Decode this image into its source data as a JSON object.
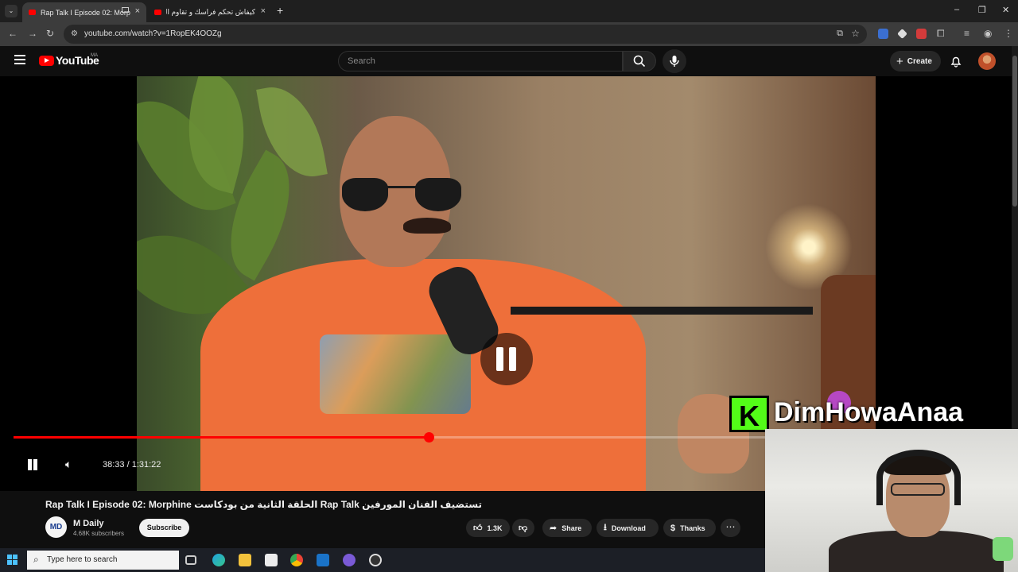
{
  "browser": {
    "tabs": [
      {
        "label": "Rap Talk I Episode 02: Morp"
      },
      {
        "label": "كيفاش تحكم فراسك و تقاوم الشو..."
      }
    ],
    "new_tab_symbol": "+",
    "url": "youtube.com/watch?v=1RopEK4OOZg"
  },
  "youtube": {
    "logo_text": "YouTube",
    "country_code": "MA",
    "search_placeholder": "Search",
    "create_label": "Create"
  },
  "player": {
    "current_time": "38:33",
    "duration": "1:31:22",
    "time_display": "38:33 / 1:31:22",
    "progress_fraction": 0.422
  },
  "video": {
    "title": "Rap Talk I Episode 02: Morphine الحلقة الثانية من بودكاست Rap Talk تستضيف الفنان المورفين",
    "channel_name": "M Daily",
    "channel_avatar_text": "MD",
    "subscribers": "4.68K subscribers",
    "subscribe_label": "Subscribe",
    "likes": "1.3K",
    "share_label": "Share",
    "download_label": "Download",
    "thanks_label": "Thanks"
  },
  "overlay": {
    "brand_letter": "K",
    "streamer_name": "DimHowaAnaa"
  },
  "taskbar": {
    "search_placeholder": "Type here to search"
  },
  "colors": {
    "accent": "#ff0000",
    "kick_green": "#53fc18",
    "background": "#0f0f0f"
  },
  "icons": [
    "menu-icon",
    "search-icon",
    "mic-icon",
    "bell-icon",
    "pause-icon",
    "volume-icon",
    "like-icon",
    "dislike-icon",
    "share-icon",
    "download-icon",
    "thanks-icon",
    "more-icon",
    "windows-icon"
  ]
}
